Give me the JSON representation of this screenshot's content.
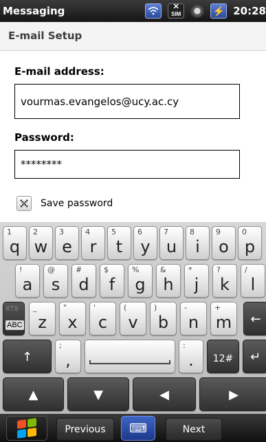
{
  "status_bar": {
    "app_title": "Messaging",
    "wifi_icon": "wifi-icon",
    "sim_label": "SIM",
    "clock": "20:28"
  },
  "header": {
    "title": "E-mail Setup"
  },
  "form": {
    "email_label": "E-mail address:",
    "email_value": "vourmas.evangelos@ucy.ac.cy",
    "password_label": "Password:",
    "password_value": "********",
    "save_password_label": "Save password",
    "save_password_checked": true
  },
  "keyboard": {
    "row1": [
      {
        "sec": "1",
        "pri": "q"
      },
      {
        "sec": "2",
        "pri": "w"
      },
      {
        "sec": "3",
        "pri": "e"
      },
      {
        "sec": "4",
        "pri": "r"
      },
      {
        "sec": "5",
        "pri": "t"
      },
      {
        "sec": "6",
        "pri": "y"
      },
      {
        "sec": "7",
        "pri": "u"
      },
      {
        "sec": "8",
        "pri": "i"
      },
      {
        "sec": "9",
        "pri": "o"
      },
      {
        "sec": "0",
        "pri": "p"
      }
    ],
    "row2": [
      {
        "sec": "!",
        "pri": "a"
      },
      {
        "sec": "@",
        "pri": "s"
      },
      {
        "sec": "#",
        "pri": "d"
      },
      {
        "sec": "$",
        "pri": "f"
      },
      {
        "sec": "%",
        "pri": "g"
      },
      {
        "sec": "&",
        "pri": "h"
      },
      {
        "sec": "*",
        "pri": "j"
      },
      {
        "sec": "?",
        "pri": "k"
      },
      {
        "sec": "/",
        "pri": "l"
      }
    ],
    "row3": [
      {
        "sec": "_",
        "pri": "z"
      },
      {
        "sec": "\"",
        "pri": "x"
      },
      {
        "sec": "'",
        "pri": "c"
      },
      {
        "sec": "(",
        "pri": "v"
      },
      {
        "sec": ")",
        "pri": "b"
      },
      {
        "sec": "-",
        "pri": "n"
      },
      {
        "sec": "+",
        "pri": "m"
      }
    ],
    "xt9_label": "XT9",
    "abc_label": "ABC",
    "backspace_symbol": "←",
    "shift_symbol": "↑",
    "semicolon_sec": ";",
    "comma_pri": ",",
    "colon_sec": ":",
    "period_pri": ".",
    "symbols_label": "12#",
    "enter_symbol": "↵",
    "arrow_up": "▲",
    "arrow_down": "▼",
    "arrow_left": "◀",
    "arrow_right": "▶"
  },
  "softkeys": {
    "previous_label": "Previous",
    "next_label": "Next",
    "keyboard_symbol": "⌨"
  },
  "colors": {
    "flag_red": "#f25022",
    "flag_green": "#7fba00",
    "flag_blue": "#00a4ef",
    "flag_yellow": "#ffb900"
  }
}
